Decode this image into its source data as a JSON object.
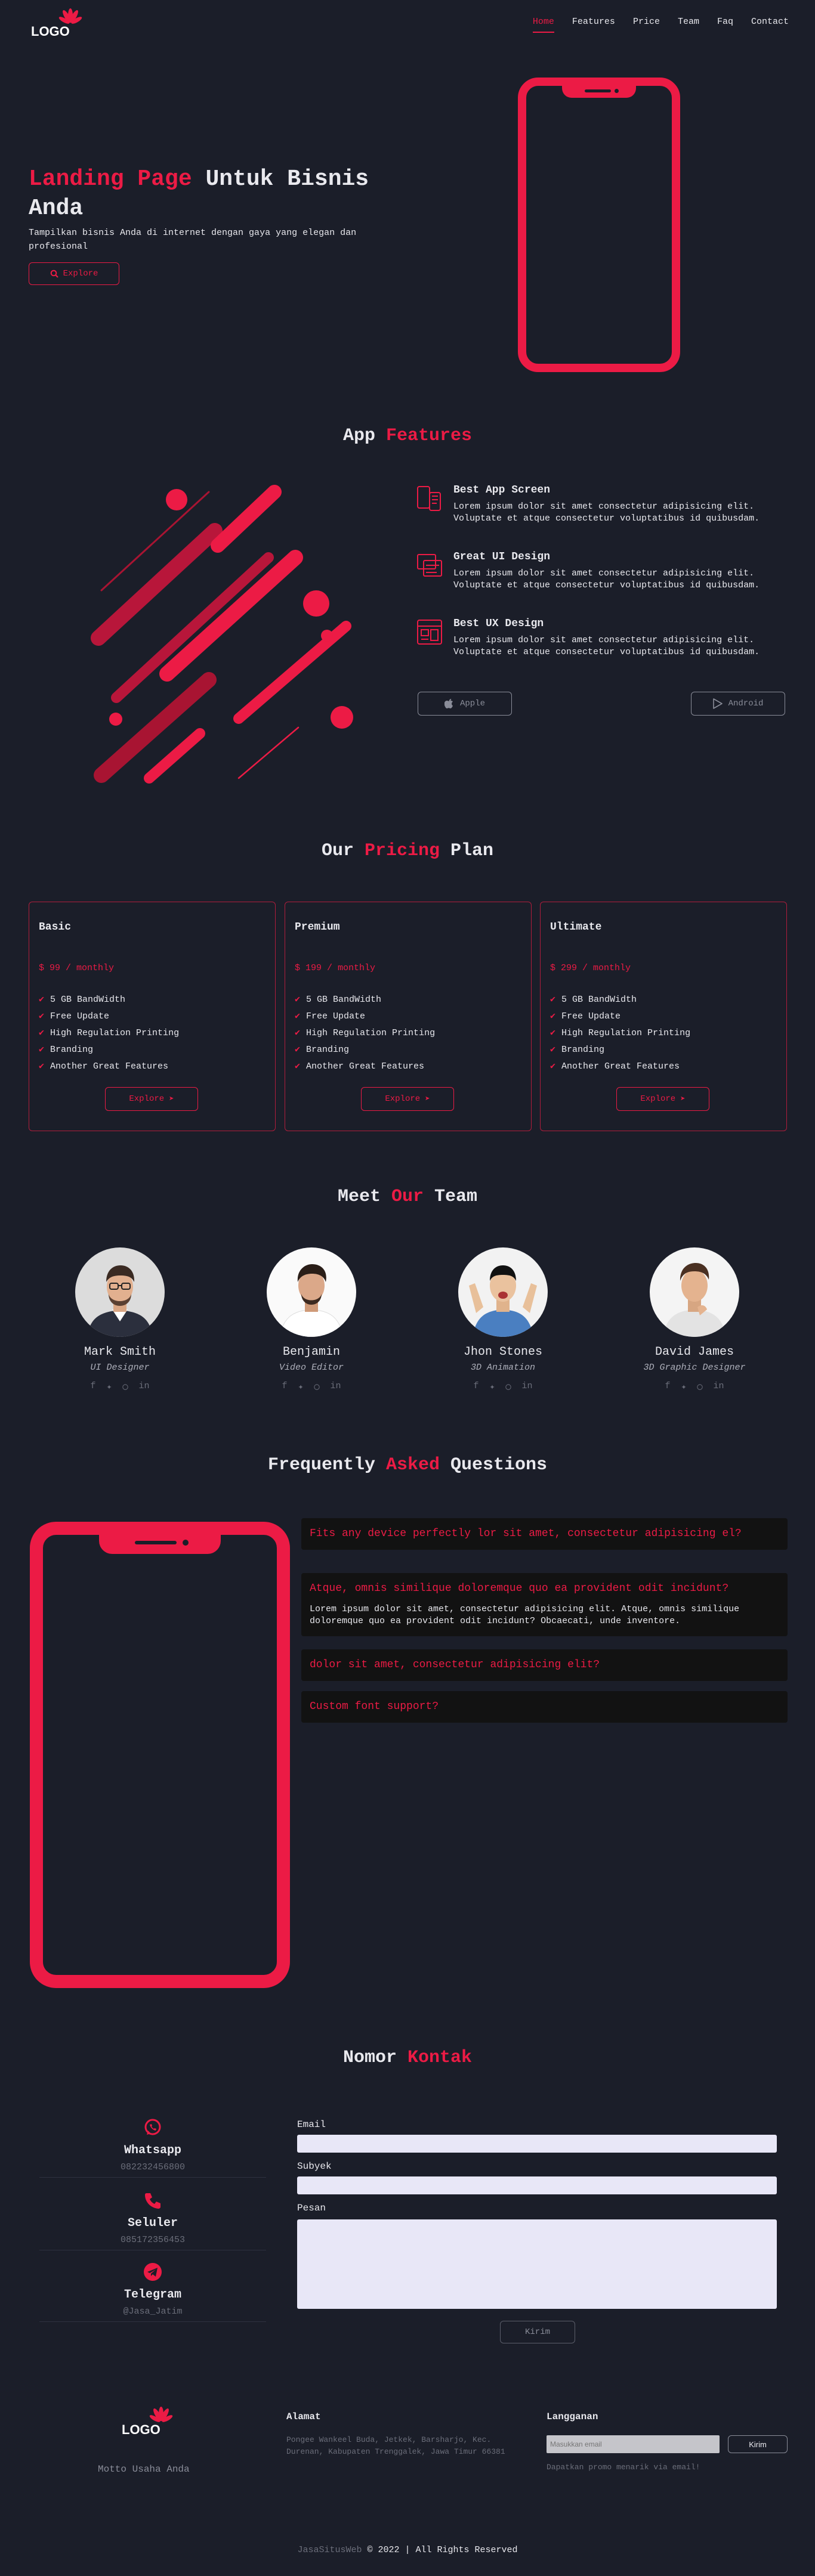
{
  "nav": {
    "logo": "LOGO",
    "items": [
      "Home",
      "Features",
      "Price",
      "Team",
      "Faq",
      "Contact"
    ]
  },
  "hero": {
    "title_red": "Landing Page",
    "title_rest": " Untuk Bisnis",
    "title_line2": "Anda",
    "text": "Tampilkan bisnis Anda di internet dengan gaya yang elegan dan profesional",
    "button": "Explore"
  },
  "features": {
    "title_a": "App",
    "title_b": "Features",
    "items": [
      {
        "title": "Best App Screen",
        "text": "Lorem ipsum dolor sit amet consectetur adipisicing elit. Voluptate et atque consectetur voluptatibus id quibusdam.",
        "icon": "mobile-screen-icon"
      },
      {
        "title": "Great UI Design",
        "text": "Lorem ipsum dolor sit amet consectetur adipisicing elit. Voluptate et atque consectetur voluptatibus id quibusdam.",
        "icon": "ui-layout-icon"
      },
      {
        "title": "Best UX Design",
        "text": "Lorem ipsum dolor sit amet consectetur adipisicing elit. Voluptate et atque consectetur voluptatibus id quibusdam.",
        "icon": "ux-design-icon"
      }
    ],
    "apple": "Apple",
    "android": "Android"
  },
  "pricing": {
    "title_a": "Our",
    "title_b": "Pricing",
    "title_c": "Plan",
    "plans": [
      {
        "name": "Basic",
        "price": "$ 99 / monthly",
        "features": [
          "5 GB BandWidth",
          "Free Update",
          "High Regulation Printing",
          "Branding",
          "Another Great Features"
        ],
        "button": "Explore"
      },
      {
        "name": "Premium",
        "price": "$ 199 / monthly",
        "features": [
          "5 GB BandWidth",
          "Free Update",
          "High Regulation Printing",
          "Branding",
          "Another Great Features"
        ],
        "button": "Explore"
      },
      {
        "name": "Ultimate",
        "price": "$ 299 / monthly",
        "features": [
          "5 GB BandWidth",
          "Free Update",
          "High Regulation Printing",
          "Branding",
          "Another Great Features"
        ],
        "button": "Explore"
      }
    ]
  },
  "team": {
    "title_a": "Meet",
    "title_b": "Our",
    "title_c": "Team",
    "members": [
      {
        "name": "Mark Smith",
        "role": "UI Designer"
      },
      {
        "name": "Benjamin",
        "role": "Video Editor"
      },
      {
        "name": "Jhon Stones",
        "role": "3D Animation"
      },
      {
        "name": "David James",
        "role": "3D Graphic Designer"
      }
    ]
  },
  "faq": {
    "title_a": "Frequently",
    "title_b": "Asked",
    "title_c": "Questions",
    "items": [
      {
        "q": "Fits any device perfectly lor sit amet, consectetur adipisicing el?"
      },
      {
        "q": "Atque, omnis similique doloremque quo ea provident odit incidunt?",
        "a": "Lorem ipsum dolor sit amet, consectetur adipisicing elit. Atque, omnis similique doloremque quo ea provident odit incidunt? Obcaecati, unde inventore."
      },
      {
        "q": "dolor sit amet, consectetur adipisicing elit?"
      },
      {
        "q": "Custom font support?"
      }
    ]
  },
  "contact": {
    "title_a": "Nomor",
    "title_b": "Kontak",
    "items": [
      {
        "label": "Whatsapp",
        "value": "082232456800",
        "icon": "whatsapp-icon"
      },
      {
        "label": "Seluler",
        "value": "085172356453",
        "icon": "phone-icon"
      },
      {
        "label": "Telegram",
        "value": "@Jasa_Jatim",
        "icon": "telegram-icon"
      }
    ],
    "form": {
      "email": "Email",
      "subject": "Subyek",
      "message": "Pesan",
      "submit": "Kirim"
    }
  },
  "footer": {
    "logo": "LOGO",
    "motto": "Motto Usaha Anda",
    "address_title": "Alamat",
    "address": "Pongee Wankeel Buda, Jetkek, Barsharjo, Kec. Durenan, Kabupaten Trenggalek, Jawa Timur 66381",
    "subscribe_title": "Langganan",
    "email_placeholder": "Masukkan email",
    "send": "Kirim",
    "subscribe_note": "Dapatkan promo menarik via email!",
    "brand": "JasaSitusWeb",
    "copyright": " © 2022 | All Rights Reserved"
  },
  "colors": {
    "accent": "#ec1b45",
    "background": "#1b1e29"
  }
}
